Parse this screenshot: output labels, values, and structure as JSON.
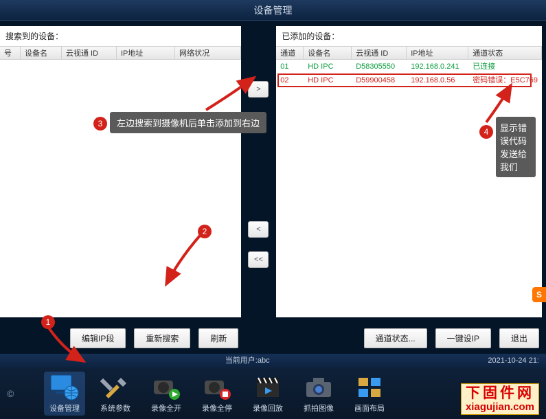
{
  "title": "设备管理",
  "left_panel": {
    "heading": "搜索到的设备：",
    "columns": [
      "号",
      "设备名",
      "云视通 ID",
      "IP地址",
      "网络状况"
    ]
  },
  "right_panel": {
    "heading": "已添加的设备：",
    "columns": [
      "通道",
      "设备名",
      "云视通 ID",
      "IP地址",
      "通道状态"
    ],
    "rows": [
      {
        "ch": "01",
        "name": "HD IPC",
        "id": "D58305550",
        "ip": "192.168.0.241",
        "status": "已连接",
        "color": "green"
      },
      {
        "ch": "02",
        "name": "HD IPC",
        "id": "D59900458",
        "ip": "192.168.0.56",
        "status": "密码错误：E5C769",
        "color": "red"
      }
    ]
  },
  "arrow_buttons": {
    "add": ">",
    "remove": "<",
    "remove_all": "<<"
  },
  "buttons": {
    "edit_ip": "编辑IP段",
    "research": "重新搜索",
    "refresh": "刷新",
    "channel_status": "通道状态...",
    "one_key_ip": "一键设IP",
    "exit": "退出"
  },
  "status": {
    "user_label": "当前用户:abc",
    "datetime": "2021-10-24  21:"
  },
  "dock": [
    {
      "key": "device",
      "label": "设备管理",
      "active": true
    },
    {
      "key": "params",
      "label": "系统参数",
      "active": false
    },
    {
      "key": "rec_on",
      "label": "录像全开",
      "active": false
    },
    {
      "key": "rec_off",
      "label": "录像全停",
      "active": false
    },
    {
      "key": "playback",
      "label": "录像回放",
      "active": false
    },
    {
      "key": "capture",
      "label": "抓拍图像",
      "active": false
    },
    {
      "key": "layout",
      "label": "画面布局",
      "active": false
    }
  ],
  "watermark": {
    "line1": "下固件网",
    "line2": "xiagujian.com"
  },
  "annotations": {
    "tip3": "左边搜索到摄像机后单击添加到右边",
    "tip4": "显示错误代码发送给我们"
  },
  "copyright": "©"
}
